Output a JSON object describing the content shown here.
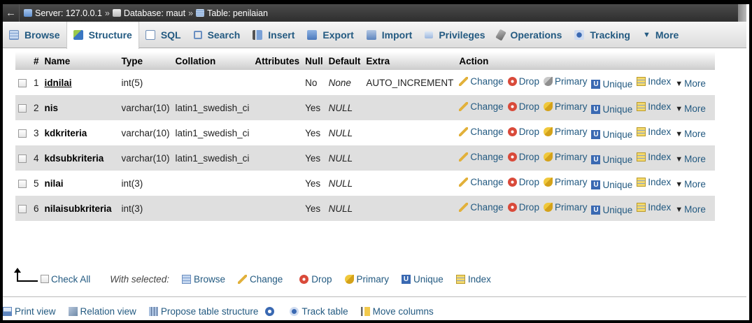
{
  "breadcrumb": {
    "back": "←",
    "server": "Server: 127.0.0.1",
    "database": "Database: maut",
    "table": "Table: penilaian",
    "sep": "»"
  },
  "tabs": [
    {
      "label": "Browse",
      "icon": "browse-icon"
    },
    {
      "label": "Structure",
      "icon": "structure-icon",
      "active": true
    },
    {
      "label": "SQL",
      "icon": "sql-icon"
    },
    {
      "label": "Search",
      "icon": "search-icon"
    },
    {
      "label": "Insert",
      "icon": "insert-icon"
    },
    {
      "label": "Export",
      "icon": "export-icon"
    },
    {
      "label": "Import",
      "icon": "import-icon"
    },
    {
      "label": "Privileges",
      "icon": "privileges-icon"
    },
    {
      "label": "Operations",
      "icon": "operations-icon"
    },
    {
      "label": "Tracking",
      "icon": "tracking-icon"
    },
    {
      "label": "More",
      "icon": "triangle-down-icon"
    }
  ],
  "table": {
    "headers": {
      "num": "#",
      "name": "Name",
      "type": "Type",
      "collation": "Collation",
      "attributes": "Attributes",
      "null": "Null",
      "default": "Default",
      "extra": "Extra",
      "action": "Action"
    },
    "rows": [
      {
        "num": "1",
        "name": "idnilai",
        "type": "int(5)",
        "collation": "",
        "attributes": "",
        "null": "No",
        "default": "None",
        "extra": "AUTO_INCREMENT"
      },
      {
        "num": "2",
        "name": "nis",
        "type": "varchar(10)",
        "collation": "latin1_swedish_ci",
        "attributes": "",
        "null": "Yes",
        "default": "NULL",
        "extra": ""
      },
      {
        "num": "3",
        "name": "kdkriteria",
        "type": "varchar(10)",
        "collation": "latin1_swedish_ci",
        "attributes": "",
        "null": "Yes",
        "default": "NULL",
        "extra": ""
      },
      {
        "num": "4",
        "name": "kdsubkriteria",
        "type": "varchar(10)",
        "collation": "latin1_swedish_ci",
        "attributes": "",
        "null": "Yes",
        "default": "NULL",
        "extra": ""
      },
      {
        "num": "5",
        "name": "nilai",
        "type": "int(3)",
        "collation": "",
        "attributes": "",
        "null": "Yes",
        "default": "NULL",
        "extra": ""
      },
      {
        "num": "6",
        "name": "nilaisubkriteria",
        "type": "int(3)",
        "collation": "",
        "attributes": "",
        "null": "Yes",
        "default": "NULL",
        "extra": ""
      }
    ],
    "actions": {
      "change": "Change",
      "drop": "Drop",
      "primary": "Primary",
      "unique": "Unique",
      "index": "Index",
      "more": "More"
    }
  },
  "bulk": {
    "check_all": "Check All",
    "with_selected": "With selected:",
    "browse": "Browse",
    "change": "Change",
    "drop": "Drop",
    "primary": "Primary",
    "unique": "Unique",
    "index": "Index"
  },
  "bottom": {
    "print_view": "Print view",
    "relation_view": "Relation view",
    "propose": "Propose table structure",
    "track_table": "Track table",
    "move_columns": "Move columns"
  }
}
